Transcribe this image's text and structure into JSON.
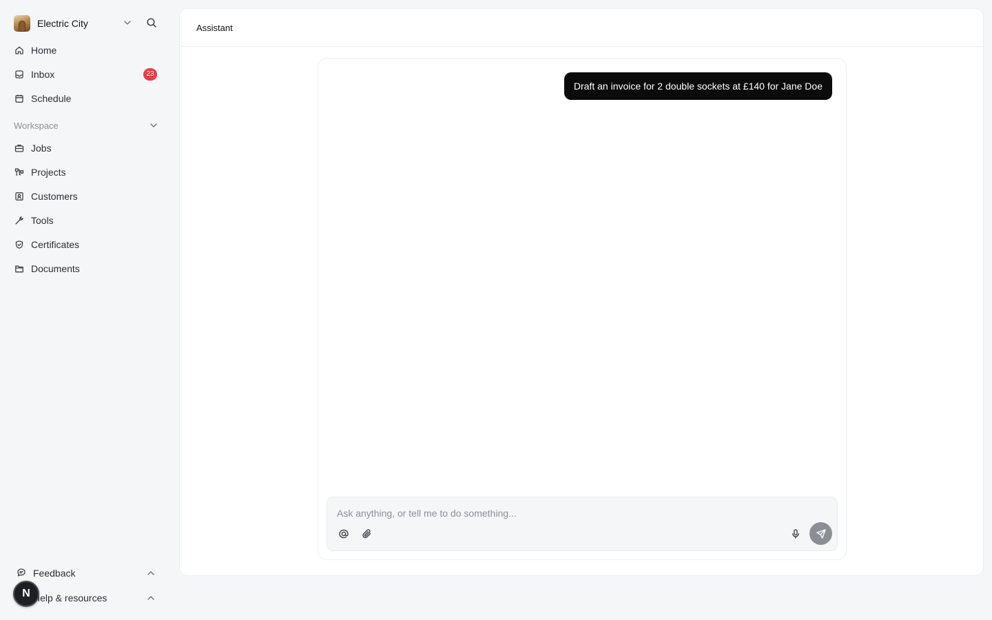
{
  "org": {
    "name": "Electric City"
  },
  "nav": {
    "home": "Home",
    "inbox": "Inbox",
    "inbox_badge": "23",
    "schedule": "Schedule"
  },
  "workspace": {
    "title": "Workspace",
    "items": [
      "Jobs",
      "Projects",
      "Customers",
      "Tools",
      "Certificates",
      "Documents"
    ]
  },
  "footer": {
    "feedback": "Feedback",
    "help": "Help & resources",
    "user_initial": "N"
  },
  "main": {
    "title": "Assistant",
    "user_message": "Draft an invoice for 2 double sockets at £140 for Jane Doe"
  },
  "composer": {
    "placeholder": "Ask anything, or tell me to do something...",
    "value": ""
  },
  "icons": {
    "home": "home-icon",
    "inbox": "inbox-icon",
    "schedule": "calendar-icon",
    "jobs": "briefcase-icon",
    "projects": "projects-icon",
    "customers": "contacts-icon",
    "tools": "wrench-icon",
    "certificates": "shield-check-icon",
    "documents": "folder-icon",
    "feedback": "chat-bubble-icon",
    "mention": "at-icon",
    "attach": "paperclip-icon",
    "mic": "microphone-icon",
    "send": "send-icon"
  },
  "colors": {
    "badge": "#ef3b42",
    "message_bubble": "#0b0b0c",
    "send_button": "#8b8f95",
    "background": "#f5f6f8"
  }
}
